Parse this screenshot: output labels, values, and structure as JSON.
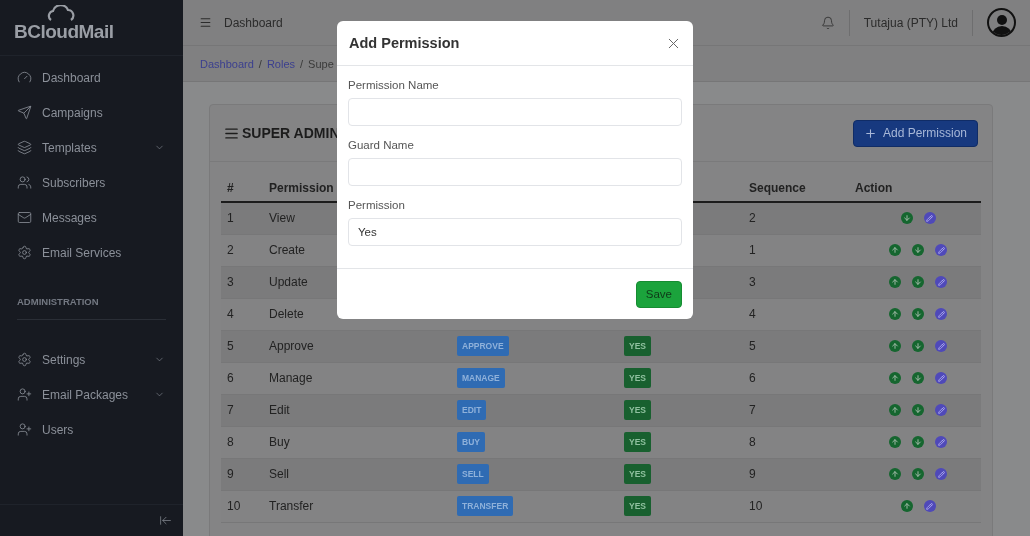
{
  "sidebar": {
    "logo": "BCloudMail",
    "items": [
      {
        "label": "Dashboard",
        "expandable": false
      },
      {
        "label": "Campaigns",
        "expandable": false
      },
      {
        "label": "Templates",
        "expandable": true
      },
      {
        "label": "Subscribers",
        "expandable": false
      },
      {
        "label": "Messages",
        "expandable": false
      },
      {
        "label": "Email Services",
        "expandable": false
      }
    ],
    "section": "ADMINISTRATION",
    "admin_items": [
      {
        "label": "Settings",
        "expandable": true
      },
      {
        "label": "Email Packages",
        "expandable": true
      },
      {
        "label": "Users",
        "expandable": false
      }
    ]
  },
  "topbar": {
    "page": "Dashboard",
    "company": "Tutajua (PTY) Ltd"
  },
  "breadcrumb": {
    "separator": "/",
    "items": [
      "Dashboard",
      "Roles",
      "Supe"
    ]
  },
  "card": {
    "title": "SUPER ADMIN",
    "add_button": "Add Permission"
  },
  "table": {
    "columns": [
      "#",
      "Permission",
      "Sequence",
      "Action"
    ],
    "rows": [
      {
        "index": "1",
        "name": "View",
        "sequence": "2",
        "actions": [
          {
            "kind": "down"
          },
          {
            "kind": "edit"
          }
        ]
      },
      {
        "index": "2",
        "name": "Create",
        "sequence": "1",
        "actions": [
          {
            "kind": "up"
          },
          {
            "kind": "down"
          },
          {
            "kind": "edit"
          }
        ]
      },
      {
        "index": "3",
        "name": "Update",
        "sequence": "3",
        "actions": [
          {
            "kind": "up"
          },
          {
            "kind": "down"
          },
          {
            "kind": "edit"
          }
        ]
      },
      {
        "index": "4",
        "name": "Delete",
        "sequence": "4",
        "actions": [
          {
            "kind": "up"
          },
          {
            "kind": "down"
          },
          {
            "kind": "edit"
          }
        ]
      },
      {
        "index": "5",
        "name": "Approve",
        "badge": "APPROVE",
        "permission": "YES",
        "sequence": "5",
        "actions": [
          {
            "kind": "up"
          },
          {
            "kind": "down"
          },
          {
            "kind": "edit"
          }
        ]
      },
      {
        "index": "6",
        "name": "Manage",
        "badge": "MANAGE",
        "permission": "YES",
        "sequence": "6",
        "actions": [
          {
            "kind": "up"
          },
          {
            "kind": "down"
          },
          {
            "kind": "edit"
          }
        ]
      },
      {
        "index": "7",
        "name": "Edit",
        "badge": "EDIT",
        "permission": "YES",
        "sequence": "7",
        "actions": [
          {
            "kind": "up"
          },
          {
            "kind": "down"
          },
          {
            "kind": "edit"
          }
        ]
      },
      {
        "index": "8",
        "name": "Buy",
        "badge": "BUY",
        "permission": "YES",
        "sequence": "8",
        "actions": [
          {
            "kind": "up"
          },
          {
            "kind": "down"
          },
          {
            "kind": "edit"
          }
        ]
      },
      {
        "index": "9",
        "name": "Sell",
        "badge": "SELL",
        "permission": "YES",
        "sequence": "9",
        "actions": [
          {
            "kind": "up"
          },
          {
            "kind": "down"
          },
          {
            "kind": "edit"
          }
        ]
      },
      {
        "index": "10",
        "name": "Transfer",
        "badge": "TRANSFER",
        "permission": "YES",
        "sequence": "10",
        "actions": [
          {
            "kind": "up"
          },
          {
            "kind": "edit"
          }
        ]
      }
    ]
  },
  "modal": {
    "title": "Add Permission",
    "fields": [
      {
        "label": "Permission Name"
      },
      {
        "label": "Guard Name"
      },
      {
        "label": "Permission",
        "value": "Yes"
      }
    ],
    "save": "Save"
  }
}
